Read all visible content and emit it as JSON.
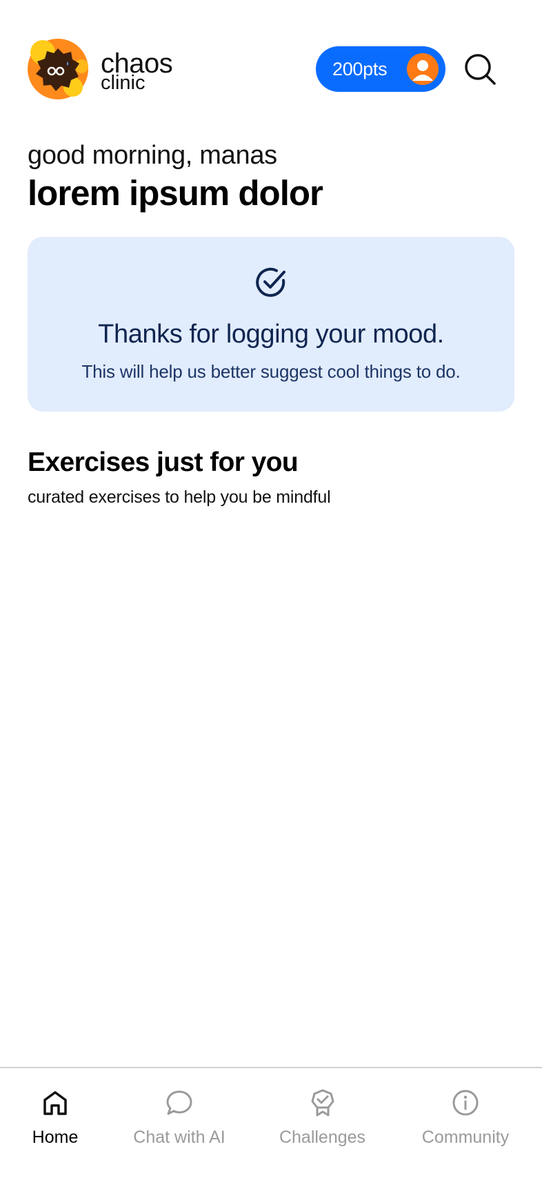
{
  "brand": {
    "name": "chaos",
    "sub": "clinic",
    "logo_icon": "chaos-clinic-logo-icon"
  },
  "header": {
    "points": "200pts",
    "avatar_icon": "user-avatar-icon",
    "search_icon": "search-icon",
    "pill_color": "#0a6cff",
    "avatar_color": "#ff7a14"
  },
  "greeting": {
    "salutation": "good morning, manas",
    "headline": "lorem ipsum dolor"
  },
  "mood_card": {
    "icon": "check-circle-icon",
    "title": "Thanks for logging your mood.",
    "subtitle": "This will help us better suggest cool things to do.",
    "background": "#e1ecfd"
  },
  "exercises": {
    "title": "Exercises just for you",
    "subtitle": "curated exercises to help you be mindful"
  },
  "nav": {
    "items": [
      {
        "label": "Home",
        "icon": "home-icon",
        "active": true
      },
      {
        "label": "Chat with AI",
        "icon": "chat-bubble-icon",
        "active": false
      },
      {
        "label": "Challenges",
        "icon": "badge-icon",
        "active": false
      },
      {
        "label": "Community",
        "icon": "info-icon",
        "active": false
      }
    ]
  }
}
